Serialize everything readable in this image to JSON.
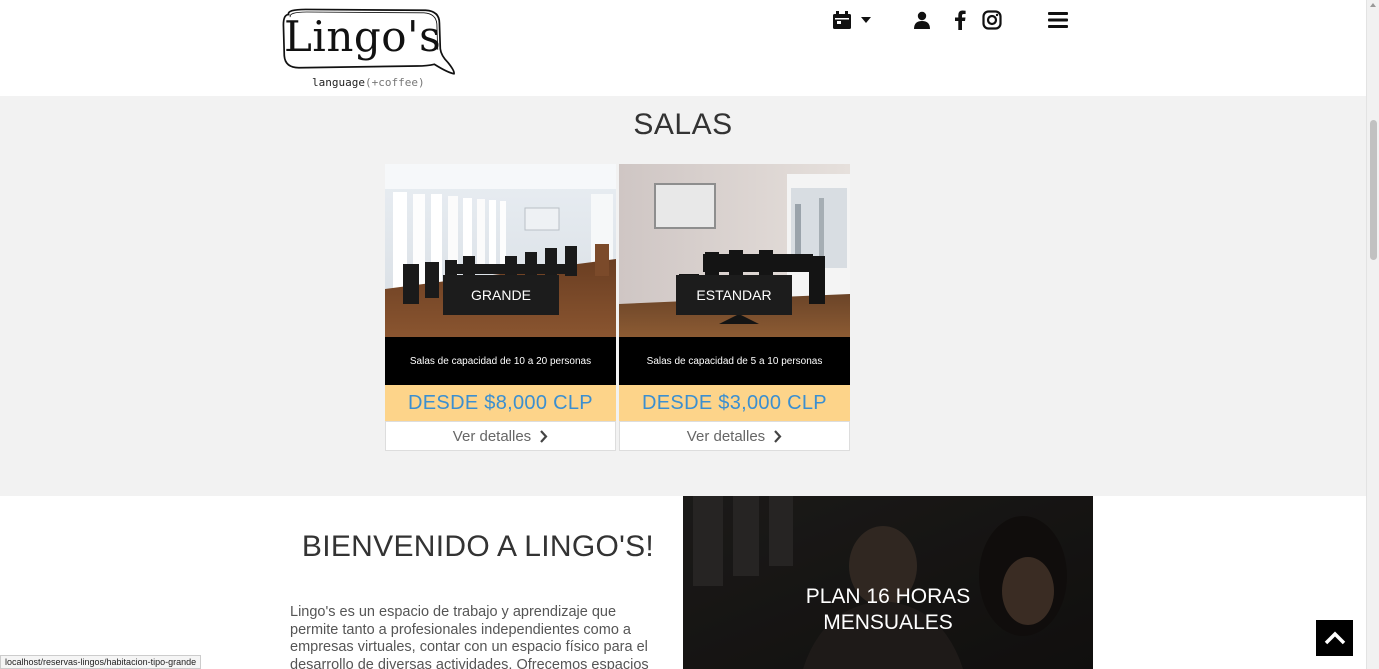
{
  "brand": {
    "name": "Lingo's",
    "sub_main": "language",
    "sub_paren": "(+coffee)"
  },
  "nav": {
    "icons": [
      "calendar-icon",
      "caret-down-icon",
      "user-icon",
      "facebook-icon",
      "instagram-icon",
      "menu-icon"
    ]
  },
  "salas": {
    "title": "SALAS",
    "cards": [
      {
        "name": "GRANDE",
        "desc": "Salas de capacidad de 10 a 20 personas",
        "price": "DESDE $8,000 CLP",
        "link": "Ver detalles"
      },
      {
        "name": "ESTANDAR",
        "desc": "Salas de capacidad de 5 a 10 personas",
        "price": "DESDE $3,000 CLP",
        "link": "Ver detalles"
      }
    ]
  },
  "welcome": {
    "title": "BIENVENIDO A LINGO'S!",
    "text_lines": [
      "Lingo's es un espacio de trabajo y aprendizaje que",
      "permite tanto a profesionales independientes como a",
      "empresas virtuales, contar con un espacio físico para el",
      "desarrollo de diversas actividades. Ofrecemos espacios"
    ]
  },
  "plan": {
    "title_line1": "PLAN 16 HORAS",
    "title_line2": "MENSUALES"
  },
  "status_bar": {
    "url": "localhost/reservas-lingos/habitacion-tipo-grande"
  },
  "colors": {
    "price_bg": "#fdd48a",
    "price_text": "#3b8fd0",
    "dark": "#1c1c1c"
  }
}
